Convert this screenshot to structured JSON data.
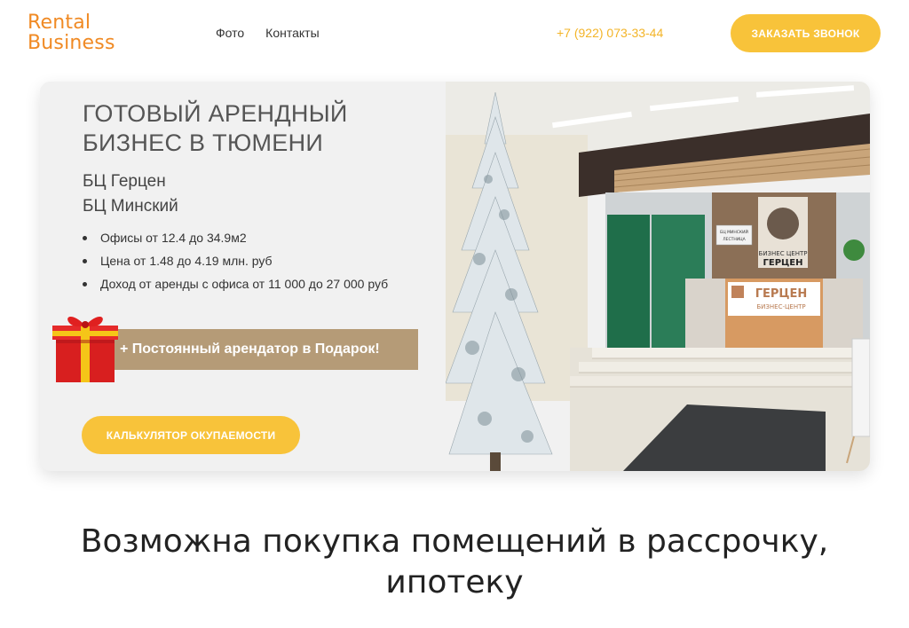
{
  "header": {
    "logo_line1": "Rental",
    "logo_line2": "Business",
    "nav": [
      {
        "label": "Фото"
      },
      {
        "label": "Контакты"
      }
    ],
    "phone": "+7 (922) 073-33-44",
    "call_button": "ЗАКАЗАТЬ ЗВОНОК"
  },
  "hero": {
    "title": "ГОТОВЫЙ АРЕНДНЫЙ БИЗНЕС В ТЮМЕНИ",
    "subtitle1": "БЦ Герцен",
    "subtitle2": "БЦ Минский",
    "bullets": [
      "Офисы от 12.4 до 34.9м2",
      "Цена от 1.48 до 4.19 млн. руб",
      "Доход от аренды с офиса от 11 000 до 27 000 руб"
    ],
    "promo": "+ Постоянный арендатор в Подарок!",
    "calc_button": "КАЛЬКУЛЯТОР ОКУПАЕМОСТИ",
    "photo": {
      "sign_main": "ГЕРЦЕН",
      "sign_sub": "БИЗНЕС-ЦЕНТР",
      "wall_sign_top": "БИЗНЕС ЦЕНТР",
      "wall_sign_main": "ГЕРЦЕН",
      "direction_sign_1": "БЦ МИНСКИЙ",
      "direction_sign_2": "ЛЕСТНИЦА"
    }
  },
  "bottom": {
    "heading_line1": "Возможна покупка помещений в рассрочку,",
    "heading_line2": "ипотеку"
  },
  "colors": {
    "accent_orange": "#f08a24",
    "button_yellow": "#f8c33a",
    "promo_tan": "#b59b77"
  }
}
